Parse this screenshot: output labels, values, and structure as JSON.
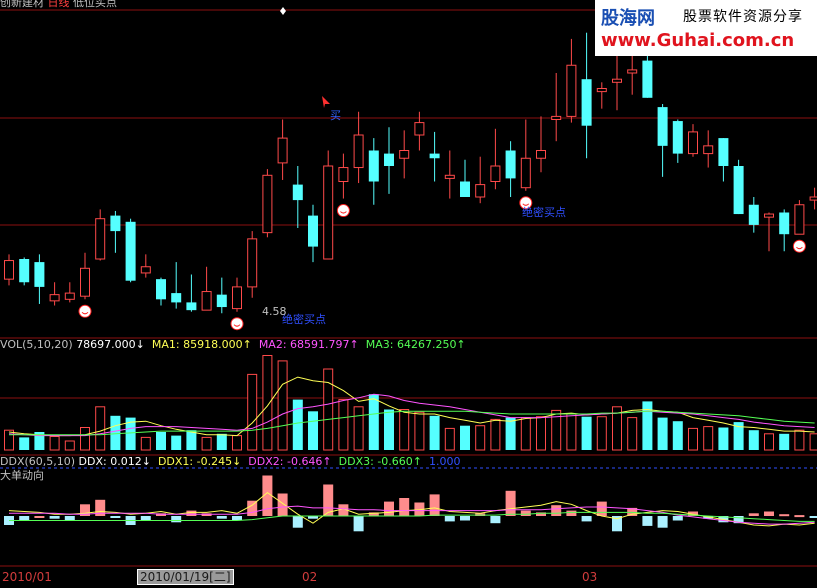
{
  "header": {
    "title_prefix": "创新建材",
    "period": "日线",
    "indicator": "低位买点"
  },
  "watermark": {
    "line1": "股海网",
    "line2": "股票软件资源分享",
    "line3": "www.Guhai.com.cn"
  },
  "annotations": {
    "buy_signal_1": "绝密买点",
    "buy_signal_2": "绝密买点",
    "arrow_mark": "买",
    "low_price_label": "4.58"
  },
  "vol": {
    "header": "VOL(5,10,20)",
    "value": "78697.000↓",
    "ma1": "MA1: 85918.000↑",
    "ma2": "MA2: 68591.797↑",
    "ma3": "MA3: 64267.250↑"
  },
  "ddx": {
    "header": "DDX(60,5,10)",
    "ddx": "DDX: 0.012↓",
    "ddx1": "DDX1: -0.245↓",
    "ddx2": "DDX2: -0.646↑",
    "ddx3": "DDX3: -0.660↑",
    "level": "1.000",
    "subtitle": "大单动向"
  },
  "x_axis": {
    "tick1": "2010/01",
    "tick2": "02",
    "tick3": "03",
    "cursor_date": "2010/01/19[二]"
  },
  "colors": {
    "up": "#ff4a4a",
    "down": "#55ffff",
    "ma1": "#ffff55",
    "ma2": "#ff55ff",
    "ma3": "#55ff55",
    "grid": "#8c1010",
    "text": "#c0c0c0"
  },
  "chart_data": {
    "type": "candlestick",
    "candles": [
      {
        "o": 7,
        "c": 19,
        "h": 23,
        "l": 3,
        "v": 22,
        "ddx": -1
      },
      {
        "o": 20,
        "c": 5,
        "h": 21,
        "l": 3,
        "v": 14,
        "ddx": -0.5
      },
      {
        "o": 18,
        "c": 2,
        "h": 23,
        "l": -9,
        "v": 20,
        "ddx": 0
      },
      {
        "o": -7,
        "c": -3,
        "h": 5,
        "l": -10,
        "v": 15,
        "ddx": -0.3
      },
      {
        "o": -6,
        "c": -2,
        "h": 5,
        "l": -8,
        "v": 10,
        "ddx": -0.5
      },
      {
        "o": -4,
        "c": 14,
        "h": 24,
        "l": -6,
        "v": 25,
        "ddx": 1.3
      },
      {
        "o": 20,
        "c": 46,
        "h": 52,
        "l": 19,
        "v": 48,
        "ddx": 1.8
      },
      {
        "o": 48,
        "c": 38,
        "h": 51,
        "l": 24,
        "v": 38,
        "ddx": -0.2
      },
      {
        "o": 44,
        "c": 6,
        "h": 46,
        "l": 5,
        "v": 36,
        "ddx": -1
      },
      {
        "o": 11,
        "c": 15,
        "h": 23,
        "l": 8,
        "v": 14,
        "ddx": -0.5
      },
      {
        "o": 7,
        "c": -6,
        "h": 8,
        "l": -10,
        "v": 20,
        "ddx": 0.3
      },
      {
        "o": -2,
        "c": -8,
        "h": 18,
        "l": -12,
        "v": 16,
        "ddx": -0.7
      },
      {
        "o": -8,
        "c": -13,
        "h": 10,
        "l": -14,
        "v": 22,
        "ddx": 0.6
      },
      {
        "o": -13,
        "c": -1,
        "h": 15,
        "l": -12,
        "v": 14,
        "ddx": 0.3
      },
      {
        "o": -3,
        "c": -11,
        "h": 8,
        "l": -15,
        "v": 18,
        "ddx": -0.3
      },
      {
        "o": -12,
        "c": 2,
        "h": 8,
        "l": -14,
        "v": 16,
        "ddx": -0.5
      },
      {
        "o": 2,
        "c": 33,
        "h": 38,
        "l": -5,
        "v": 84,
        "ddx": 1.7
      },
      {
        "o": 37,
        "c": 74,
        "h": 78,
        "l": 34,
        "v": 105,
        "ddx": 4.5
      },
      {
        "o": 82,
        "c": 98,
        "h": 110,
        "l": 71,
        "v": 99,
        "ddx": 2.5
      },
      {
        "o": 68,
        "c": 58,
        "h": 80,
        "l": 40,
        "v": 56,
        "ddx": -1.3
      },
      {
        "o": 48,
        "c": 28,
        "h": 55,
        "l": 18,
        "v": 43,
        "ddx": -0.3
      },
      {
        "o": 20,
        "c": 80,
        "h": 90,
        "l": 20,
        "v": 90,
        "ddx": 3.5
      },
      {
        "o": 70,
        "c": 79,
        "h": 88,
        "l": 59,
        "v": 56,
        "ddx": 1.3
      },
      {
        "o": 79,
        "c": 100,
        "h": 115,
        "l": 69,
        "v": 48,
        "ddx": -1.7
      },
      {
        "o": 90,
        "c": 70,
        "h": 98,
        "l": 55,
        "v": 62,
        "ddx": 0.4
      },
      {
        "o": 88,
        "c": 80,
        "h": 105,
        "l": 62,
        "v": 45,
        "ddx": 1.6
      },
      {
        "o": 85,
        "c": 90,
        "h": 103,
        "l": 72,
        "v": 45,
        "ddx": 2.0
      },
      {
        "o": 100,
        "c": 108,
        "h": 115,
        "l": 90,
        "v": 42,
        "ddx": 1.5
      },
      {
        "o": 88,
        "c": 85,
        "h": 102,
        "l": 70,
        "v": 38,
        "ddx": 2.4
      },
      {
        "o": 72,
        "c": 74,
        "h": 90,
        "l": 59,
        "v": 24,
        "ddx": -0.6
      },
      {
        "o": 70,
        "c": 60,
        "h": 84,
        "l": 62,
        "v": 27,
        "ddx": -0.5
      },
      {
        "o": 60,
        "c": 68,
        "h": 86,
        "l": 56,
        "v": 27,
        "ddx": 0.3
      },
      {
        "o": 70,
        "c": 80,
        "h": 104,
        "l": 65,
        "v": 34,
        "ddx": -0.8
      },
      {
        "o": 90,
        "c": 72,
        "h": 96,
        "l": 60,
        "v": 36,
        "ddx": 2.8
      },
      {
        "o": 66,
        "c": 85,
        "h": 110,
        "l": 64,
        "v": 36,
        "ddx": 0.6
      },
      {
        "o": 85,
        "c": 90,
        "h": 112,
        "l": 76,
        "v": 37,
        "ddx": 0.4
      },
      {
        "o": 110,
        "c": 112,
        "h": 140,
        "l": 96,
        "v": 44,
        "ddx": 1.2
      },
      {
        "o": 112,
        "c": 145,
        "h": 162,
        "l": 108,
        "v": 40,
        "ddx": 0.6
      },
      {
        "o": 136,
        "c": 106,
        "h": 166,
        "l": 85,
        "v": 37,
        "ddx": -0.6
      },
      {
        "o": 128,
        "c": 130,
        "h": 134,
        "l": 117,
        "v": 37,
        "ddx": 1.6
      },
      {
        "o": 134,
        "c": 136,
        "h": 156,
        "l": 116,
        "v": 48,
        "ddx": -1.7
      },
      {
        "o": 140,
        "c": 142,
        "h": 172,
        "l": 126,
        "v": 36,
        "ddx": 0.9
      },
      {
        "o": 148,
        "c": 124,
        "h": 153,
        "l": 124,
        "v": 54,
        "ddx": -1.1
      },
      {
        "o": 118,
        "c": 93,
        "h": 120,
        "l": 73,
        "v": 36,
        "ddx": -1.3
      },
      {
        "o": 109,
        "c": 88,
        "h": 110,
        "l": 82,
        "v": 32,
        "ddx": -0.5
      },
      {
        "o": 88,
        "c": 102,
        "h": 107,
        "l": 86,
        "v": 24,
        "ddx": 0.5
      },
      {
        "o": 88,
        "c": 93,
        "h": 103,
        "l": 79,
        "v": 26,
        "ddx": -0.3
      },
      {
        "o": 98,
        "c": 80,
        "h": 98,
        "l": 70,
        "v": 25,
        "ddx": -0.7
      },
      {
        "o": 80,
        "c": 49,
        "h": 84,
        "l": 49,
        "v": 31,
        "ddx": -0.8
      },
      {
        "o": 55,
        "c": 42,
        "h": 60,
        "l": 37,
        "v": 22,
        "ddx": 0.3
      },
      {
        "o": 47,
        "c": 49,
        "h": 50,
        "l": 25,
        "v": 18,
        "ddx": 0.5
      },
      {
        "o": 50,
        "c": 36,
        "h": 52,
        "l": 25,
        "v": 18,
        "ddx": 0.2
      },
      {
        "o": 36,
        "c": 55,
        "h": 58,
        "l": 36,
        "v": 22,
        "ddx": 0.1
      },
      {
        "o": 58,
        "c": 60,
        "h": 66,
        "l": 52,
        "v": 18,
        "ddx": -0.2
      }
    ],
    "ma1_vol": [
      20,
      18,
      17,
      16,
      16,
      17,
      21,
      27,
      31,
      32,
      27,
      23,
      20,
      17,
      17,
      16,
      30,
      49,
      73,
      81,
      77,
      75,
      66,
      54,
      57,
      49,
      42,
      40,
      40,
      36,
      33,
      30,
      33,
      32,
      35,
      36,
      40,
      41,
      39,
      40,
      41,
      44,
      45,
      43,
      42,
      36,
      33,
      30,
      26,
      25,
      23,
      21,
      21,
      20
    ],
    "ma2_vol": [
      18,
      17,
      16,
      16,
      16,
      16,
      18,
      21,
      24,
      26,
      26,
      26,
      25,
      24,
      23,
      22,
      24,
      31,
      40,
      46,
      48,
      51,
      55,
      58,
      62,
      60,
      55,
      52,
      50,
      48,
      45,
      42,
      39,
      36,
      36,
      36,
      37,
      38,
      39,
      40,
      41,
      42,
      43,
      42,
      41,
      40,
      38,
      36,
      34,
      31,
      29,
      27,
      26,
      25
    ],
    "ma3_vol": [
      17,
      17,
      17,
      17,
      17,
      17,
      17,
      18,
      19,
      20,
      21,
      21,
      21,
      21,
      21,
      21,
      22,
      24,
      27,
      30,
      32,
      34,
      36,
      38,
      40,
      42,
      43,
      43,
      43,
      43,
      43,
      42,
      41,
      40,
      40,
      40,
      40,
      40,
      40,
      41,
      41,
      42,
      43,
      43,
      42,
      41,
      40,
      39,
      38,
      36,
      34,
      32,
      31,
      30
    ],
    "ddx1_line": [
      0.6,
      0.5,
      0.4,
      0.2,
      0.2,
      0.3,
      0.5,
      0.4,
      0.2,
      0.3,
      0.5,
      0.2,
      0.4,
      0.4,
      0.6,
      0.3,
      1.2,
      2.6,
      1.4,
      0.2,
      -0.8,
      0.4,
      0.8,
      0.2,
      0.3,
      0.4,
      0.6,
      0.7,
      0.9,
      0.5,
      0.4,
      0.3,
      0.6,
      0.8,
      1.0,
      1.2,
      1.6,
      1.3,
      0.6,
      0.0,
      -0.3,
      0.2,
      0.4,
      0.6,
      0.5,
      0.2,
      -0.1,
      -0.4,
      -0.7,
      -1.0,
      -1.1,
      -0.9,
      -1.0,
      -0.8
    ],
    "ddx2_line": [
      0.3,
      0.3,
      0.3,
      0.3,
      0.2,
      0.2,
      0.3,
      0.3,
      0.3,
      0.3,
      0.2,
      0.2,
      0.2,
      0.2,
      0.2,
      0.2,
      0.4,
      0.8,
      1.0,
      1.1,
      0.9,
      0.9,
      0.8,
      0.7,
      0.7,
      0.6,
      0.6,
      0.6,
      0.6,
      0.6,
      0.6,
      0.6,
      0.6,
      0.7,
      0.7,
      0.7,
      0.8,
      0.9,
      1.0,
      1.0,
      0.9,
      0.8,
      0.6,
      0.4,
      0.1,
      -0.1,
      -0.3,
      -0.5,
      -0.7,
      -0.8,
      -0.9,
      -0.9,
      -0.8,
      -0.7
    ],
    "ddx3_line": [
      -0.5,
      -0.5,
      -0.5,
      -0.5,
      -0.5,
      -0.5,
      -0.5,
      -0.5,
      -0.5,
      -0.5,
      -0.5,
      -0.5,
      -0.5,
      -0.5,
      -0.5,
      -0.5,
      -0.4,
      -0.2,
      0.0,
      0.0,
      0.0,
      0.0,
      0.0,
      0.0,
      0.0,
      0.0,
      0.0,
      0.0,
      0.1,
      0.1,
      0.1,
      0.1,
      0.1,
      0.2,
      0.2,
      0.3,
      0.3,
      0.4,
      0.4,
      0.4,
      0.4,
      0.4,
      0.3,
      0.3,
      0.2,
      0.1,
      0.0,
      -0.1,
      -0.2,
      -0.3,
      -0.4,
      -0.5,
      -0.6,
      -0.6
    ]
  }
}
